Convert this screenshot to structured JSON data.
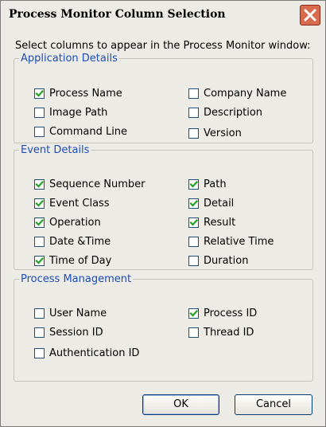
{
  "dialog": {
    "title": "Process Monitor Column Selection",
    "intro": "Select columns to appear in the Process Monitor window:",
    "ok_label": "OK",
    "cancel_label": "Cancel"
  },
  "groups": [
    {
      "title": "Application Details",
      "items": [
        {
          "label": "Process Name",
          "checked": true
        },
        {
          "label": "Image Path",
          "checked": false
        },
        {
          "label": "Command Line",
          "checked": false
        },
        {
          "label": "Company Name",
          "checked": false
        },
        {
          "label": "Description",
          "checked": false
        },
        {
          "label": "Version",
          "checked": false
        }
      ]
    },
    {
      "title": "Event Details",
      "items": [
        {
          "label": "Sequence Number",
          "checked": true
        },
        {
          "label": "Event Class",
          "checked": true
        },
        {
          "label": "Operation",
          "checked": true
        },
        {
          "label": "Date &Time",
          "checked": false
        },
        {
          "label": "Time of Day",
          "checked": true
        },
        {
          "label": "Path",
          "checked": true
        },
        {
          "label": "Detail",
          "checked": true
        },
        {
          "label": "Result",
          "checked": true
        },
        {
          "label": "Relative Time",
          "checked": false
        },
        {
          "label": "Duration",
          "checked": false
        }
      ]
    },
    {
      "title": "Process Management",
      "items": [
        {
          "label": "User Name",
          "checked": false
        },
        {
          "label": "Session ID",
          "checked": false
        },
        {
          "label": "Authentication ID",
          "checked": false
        },
        {
          "label": "Process ID",
          "checked": true
        },
        {
          "label": "Thread ID",
          "checked": false
        }
      ]
    }
  ],
  "colors": {
    "group_title": "#1e4eb8",
    "check_mark": "#21a121",
    "close_button": "#d86a4d"
  },
  "icons": {
    "close": "close-x-icon",
    "check": "check-mark-icon"
  }
}
